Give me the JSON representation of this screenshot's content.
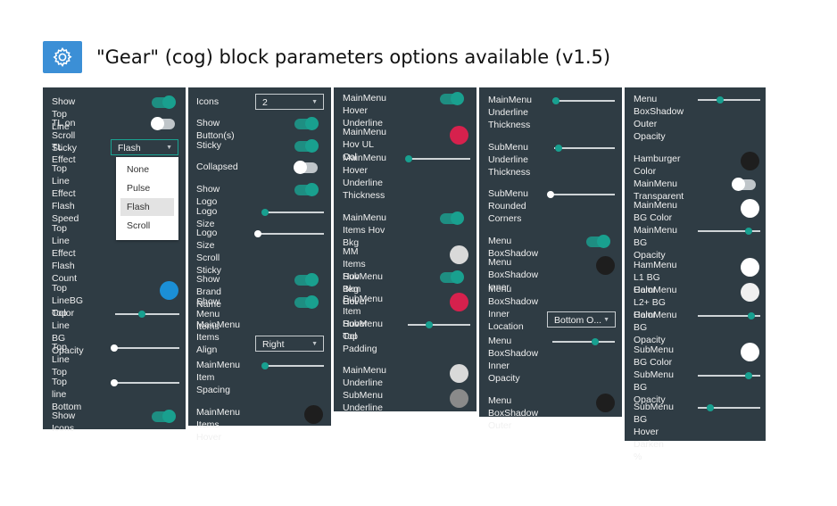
{
  "header": {
    "title": "\"Gear\" (cog) block parameters options available (v1.5)"
  },
  "colors": {
    "panel_bg": "#2f3c44",
    "toggle_on": "#19a08f",
    "slider_thumb_teal": "#18a090",
    "blue_swatch": "#1b8fd6",
    "red_swatch": "#d6214d",
    "black_swatch": "#1e1e1e",
    "gear_bg": "#3b8fd6"
  },
  "panel1": {
    "show_top_line": "Show Top Line",
    "tl_scroll_sticky": "TL on Scroll Sticky",
    "tl_effect": "TL Effect",
    "tl_effect_value": "Flash",
    "top_line_effect_flash_speed": "Top Line\nEffect\nFlash\nSpeed",
    "top_line_effect_flash_count": "Top Line\nEffect\nFlash\nCount",
    "top_line_bg_color": "Top LineBG Color",
    "top_line_bg_opacity": "Top Line\nBG Opacity",
    "top_line_top": "Top Line\nTop",
    "top_line_bottom": "Top line\nBottom",
    "show_icons": "Show Icons",
    "dropdown_options": [
      "None",
      "Pulse",
      "Flash",
      "Scroll"
    ]
  },
  "panel2": {
    "icons": "Icons",
    "icons_value": "2",
    "show_buttons": "Show Button(s)",
    "sticky": "Sticky",
    "collapsed": "Collapsed",
    "show_logo": "Show Logo",
    "logo_size": "Logo Size",
    "logo_size_scroll_sticky": "Logo Size\nScroll\nSticky",
    "show_brand_name": "Show Brand Name",
    "show_menu_items": "Show Menu Items",
    "mainmenu_items_align": "MainMenu Items Align",
    "align_value": "Right",
    "mainmenu_item_spacing": "MainMenu\nItem\nSpacing",
    "mainmenu_items_hover": "MainMenu Items Hover"
  },
  "panel3": {
    "mainmenu_hover_underline": "MainMenu Hover\nUnderline",
    "mainmenu_hov_ul_col": "MainMenu Hov UL Col",
    "mainmenu_hover_underline_thickness": "MainMenu\nHover\nUnderline\nThickness",
    "mainmenu_items_hov_bkg": "MainMenu Items Hov\nBkg",
    "mm_items_hov_bkg_col": "MM Items Hov Bkg Col",
    "submenu_item_hover": "SubMenu Item Hover",
    "submenu_item_hover_col": "SubMenu Item Hover Col",
    "submenu_top_padding": "SubMenu\nTop\nPadding",
    "mainmenu_underline": "MainMenu Underline",
    "submenu_underline": "SubMenu Underline"
  },
  "panel4": {
    "mainmenu_underline_thickness": "MainMenu\nUnderline\nThickness",
    "submenu_underline_thickness": "SubMenu\nUnderline\nThickness",
    "submenu_rounded_corners": "SubMenu\nRounded\nCorners",
    "menu_boxshadow": "Menu BoxShadow",
    "menu_boxshadow_inner": "Menu BoxShadow Inner",
    "menu_boxshadow_inner_location": "Menu BoxShadow Inner\nLocation",
    "location_value": "Bottom O...",
    "menu_boxshadow_inner_opacity": "Menu\nBoxShadow\nInner\nOpacity",
    "menu_boxshadow_outer": "Menu BoxShadow Outer"
  },
  "panel5": {
    "menu_boxshadow_outer_opacity": "Menu\nBoxShadow\nOuter\nOpacity",
    "hamburger_color": "Hamburger Color",
    "mainmenu_transparent": "MainMenu Transparent",
    "mainmenu_bg_color": "MainMenu BG Color",
    "mainmenu_bg_opacity": "MainMenu\nBG Opacity",
    "hammenu_l1_bg_color": "HamMenu L1 BG Color",
    "hammenu_l2_bg_color": "HamMenu L2+ BG Color",
    "hammenu_bg_opacity": "HamMenu\nBG Opacity",
    "submenu_bg_color": "SubMenu BG Color",
    "submenu_bg_opacity": "SubMenu\nBG Opacity",
    "submenu_bg_hover_darken": "SubMenu\nBG Hover\nDarken %"
  }
}
